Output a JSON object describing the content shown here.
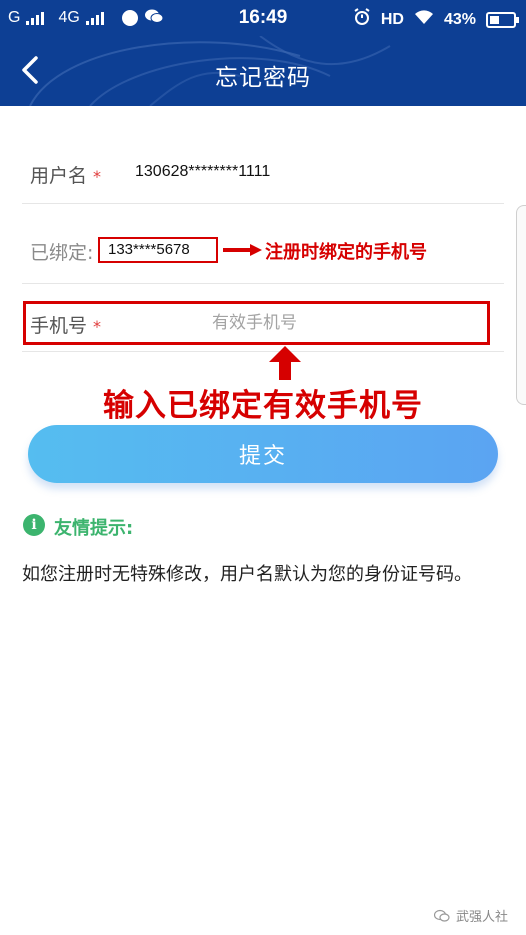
{
  "status_bar": {
    "carrier1": "G",
    "carrier2": "4G",
    "time": "16:49",
    "hd": "HD",
    "battery": "43%",
    "battery_level": 0.43
  },
  "header": {
    "title": "忘记密码",
    "back_icon": "chevron-left-icon"
  },
  "form": {
    "username_label": "用户名",
    "username_value": "130628********1111",
    "bound_label": "已绑定:",
    "bound_value": "133****5678",
    "phone_label": "手机号",
    "phone_placeholder": "有效手机号",
    "required_mark": "*"
  },
  "annotations": {
    "bound_note": "注册时绑定的手机号",
    "phone_note": "输入已绑定有效手机号"
  },
  "submit_label": "提交",
  "tip": {
    "icon": "info-icon",
    "title": "友情提示:",
    "text": "如您注册时无特殊修改，用户名默认为您的身份证号码。"
  },
  "watermark": "武强人社",
  "colors": {
    "header": "#0d3f94",
    "accent_red": "#d60000",
    "tip_green": "#3cb46e",
    "button_start": "#55bdf0",
    "button_end": "#5ba4f2"
  }
}
